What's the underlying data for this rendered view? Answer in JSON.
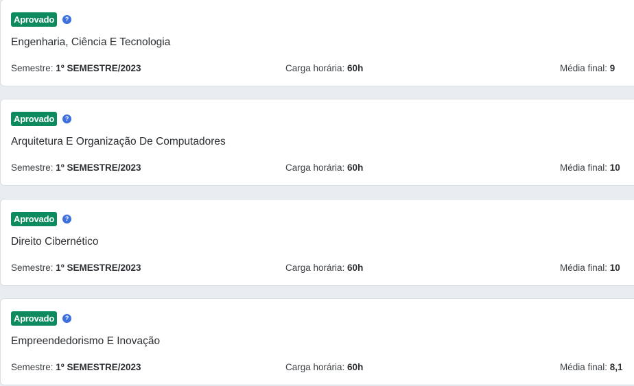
{
  "common": {
    "semester_label": "Semestre: ",
    "hours_label": "Carga horária: ",
    "grade_label": "Média final: "
  },
  "courses": [
    {
      "status": "Aprovado",
      "help": "?",
      "title": "Engenharia, Ciência E Tecnologia",
      "semester": "1º SEMESTRE/2023",
      "hours": "60h",
      "grade": "9"
    },
    {
      "status": "Aprovado",
      "help": "?",
      "title": "Arquitetura E Organização De Computadores",
      "semester": "1º SEMESTRE/2023",
      "hours": "60h",
      "grade": "10"
    },
    {
      "status": "Aprovado",
      "help": "?",
      "title": "Direito Cibernético",
      "semester": "1º SEMESTRE/2023",
      "hours": "60h",
      "grade": "10"
    },
    {
      "status": "Aprovado",
      "help": "?",
      "title": "Empreendedorismo E Inovação",
      "semester": "1º SEMESTRE/2023",
      "hours": "60h",
      "grade": "8,1"
    }
  ],
  "colors": {
    "approved_badge": "#0e8a5f",
    "help_icon": "#3c6fe0",
    "page_background": "#e9edf1"
  }
}
